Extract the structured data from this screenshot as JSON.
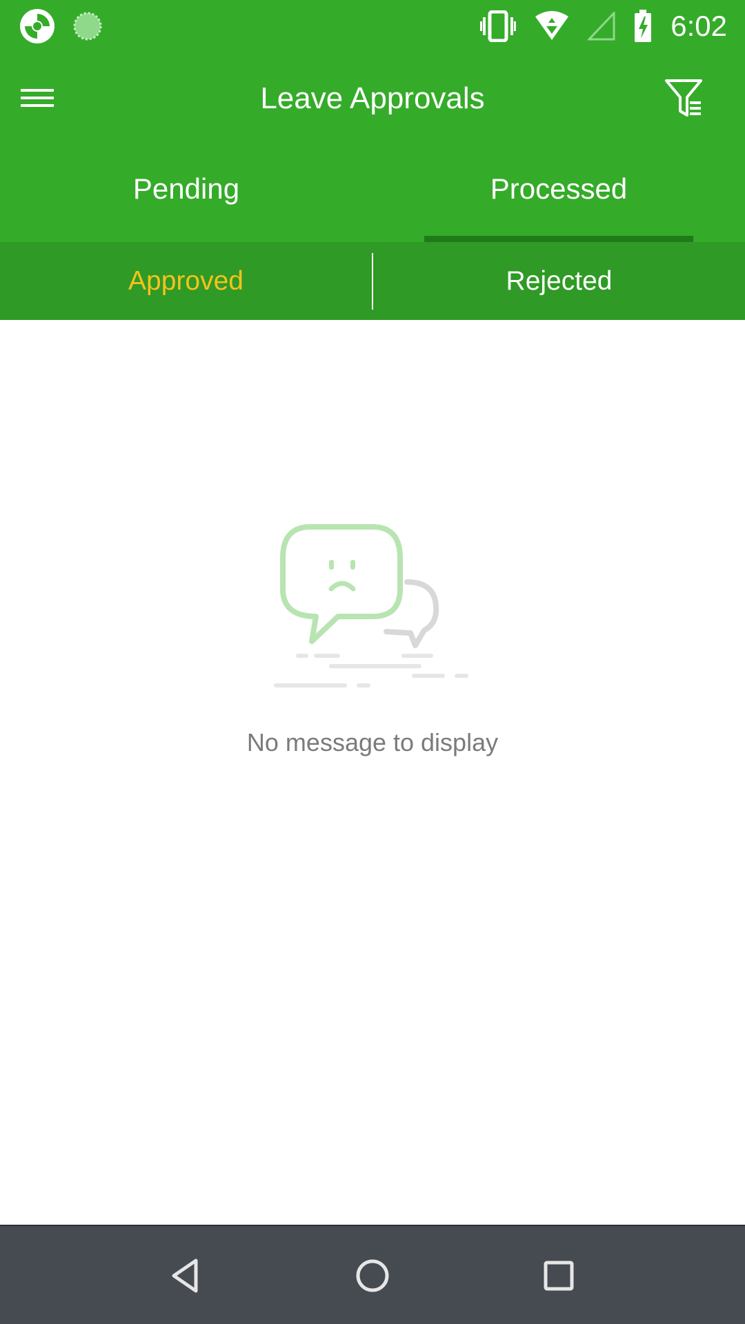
{
  "status_bar": {
    "time": "6:02",
    "icons": [
      "app-logo-icon",
      "sync-icon",
      "vibrate-icon",
      "wifi-icon",
      "cell-signal-icon",
      "battery-charging-icon"
    ]
  },
  "app_bar": {
    "title": "Leave Approvals",
    "menu_icon": "hamburger-menu-icon",
    "filter_icon": "filter-icon"
  },
  "tabs": [
    {
      "label": "Pending",
      "active": false
    },
    {
      "label": "Processed",
      "active": true
    }
  ],
  "subtabs": [
    {
      "label": "Approved",
      "active": true
    },
    {
      "label": "Rejected",
      "active": false
    }
  ],
  "empty_state": {
    "message": "No message to display",
    "icon": "sad-chat-bubble-icon"
  },
  "nav_bar": {
    "icons": [
      "back-icon",
      "home-icon",
      "recents-icon"
    ]
  },
  "colors": {
    "primary": "#35ab2a",
    "subtab_bg": "#2f9a25",
    "indicator": "#1f7a19",
    "accent": "#f4c21e",
    "nav_bar": "#454b51"
  }
}
